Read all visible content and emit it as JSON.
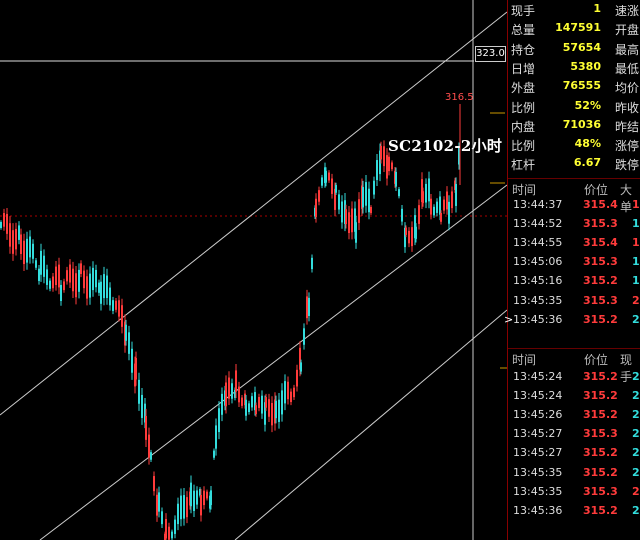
{
  "chart": {
    "title": "SC2102-2小时",
    "price_tag": "323.0",
    "high_label": "316.5"
  },
  "colors": {
    "up": "#ff3b3b",
    "down": "#33dddd",
    "value": "#ffff33",
    "bg": "#000000"
  },
  "stats": [
    {
      "label": "现手",
      "value": "1",
      "right": "速涨"
    },
    {
      "label": "总量",
      "value": "147591",
      "right": "开盘"
    },
    {
      "label": "持仓",
      "value": "57654",
      "right": "最高"
    },
    {
      "label": "日增",
      "value": "5380",
      "right": "最低"
    },
    {
      "label": "外盘",
      "value": "76555",
      "right": "均价"
    },
    {
      "label": "比例",
      "value": "52%",
      "right": "昨收"
    },
    {
      "label": "内盘",
      "value": "71036",
      "right": "昨结"
    },
    {
      "label": "比例",
      "value": "48%",
      "right": "涨停"
    },
    {
      "label": "杠杆",
      "value": "6.67",
      "right": "跌停"
    }
  ],
  "ticks_a": {
    "headers": {
      "time": "时间",
      "price": "价位",
      "vol": "大单"
    },
    "rows": [
      {
        "time": "13:44:37",
        "price": "315.4",
        "pcolor": "red",
        "vol": "1",
        "vcolor": "red"
      },
      {
        "time": "13:44:52",
        "price": "315.3",
        "pcolor": "red",
        "vol": "1",
        "vcolor": "cyan"
      },
      {
        "time": "13:44:55",
        "price": "315.4",
        "pcolor": "red",
        "vol": "1",
        "vcolor": "red"
      },
      {
        "time": "13:45:06",
        "price": "315.3",
        "pcolor": "red",
        "vol": "1",
        "vcolor": "cyan"
      },
      {
        "time": "13:45:16",
        "price": "315.2",
        "pcolor": "red",
        "vol": "1",
        "vcolor": "cyan"
      },
      {
        "time": "13:45:35",
        "price": "315.3",
        "pcolor": "red",
        "vol": "2",
        "vcolor": "red"
      },
      {
        "time": "13:45:36",
        "price": "315.2",
        "pcolor": "red",
        "vol": "2",
        "vcolor": "cyan"
      }
    ]
  },
  "ticks_b": {
    "headers": {
      "time": "时间",
      "price": "价位",
      "vol": "现手"
    },
    "rows": [
      {
        "time": "13:45:24",
        "price": "315.2",
        "pcolor": "red",
        "vol": "2",
        "vcolor": "cyan"
      },
      {
        "time": "13:45:24",
        "price": "315.2",
        "pcolor": "red",
        "vol": "2",
        "vcolor": "cyan"
      },
      {
        "time": "13:45:26",
        "price": "315.2",
        "pcolor": "red",
        "vol": "2",
        "vcolor": "cyan"
      },
      {
        "time": "13:45:27",
        "price": "315.3",
        "pcolor": "red",
        "vol": "2",
        "vcolor": "cyan"
      },
      {
        "time": "13:45:27",
        "price": "315.2",
        "pcolor": "red",
        "vol": "2",
        "vcolor": "cyan"
      },
      {
        "time": "13:45:35",
        "price": "315.2",
        "pcolor": "red",
        "vol": "2",
        "vcolor": "cyan"
      },
      {
        "time": "13:45:35",
        "price": "315.3",
        "pcolor": "red",
        "vol": "2",
        "vcolor": "red"
      },
      {
        "time": "13:45:36",
        "price": "315.2",
        "pcolor": "red",
        "vol": "2",
        "vcolor": "cyan"
      }
    ]
  }
}
